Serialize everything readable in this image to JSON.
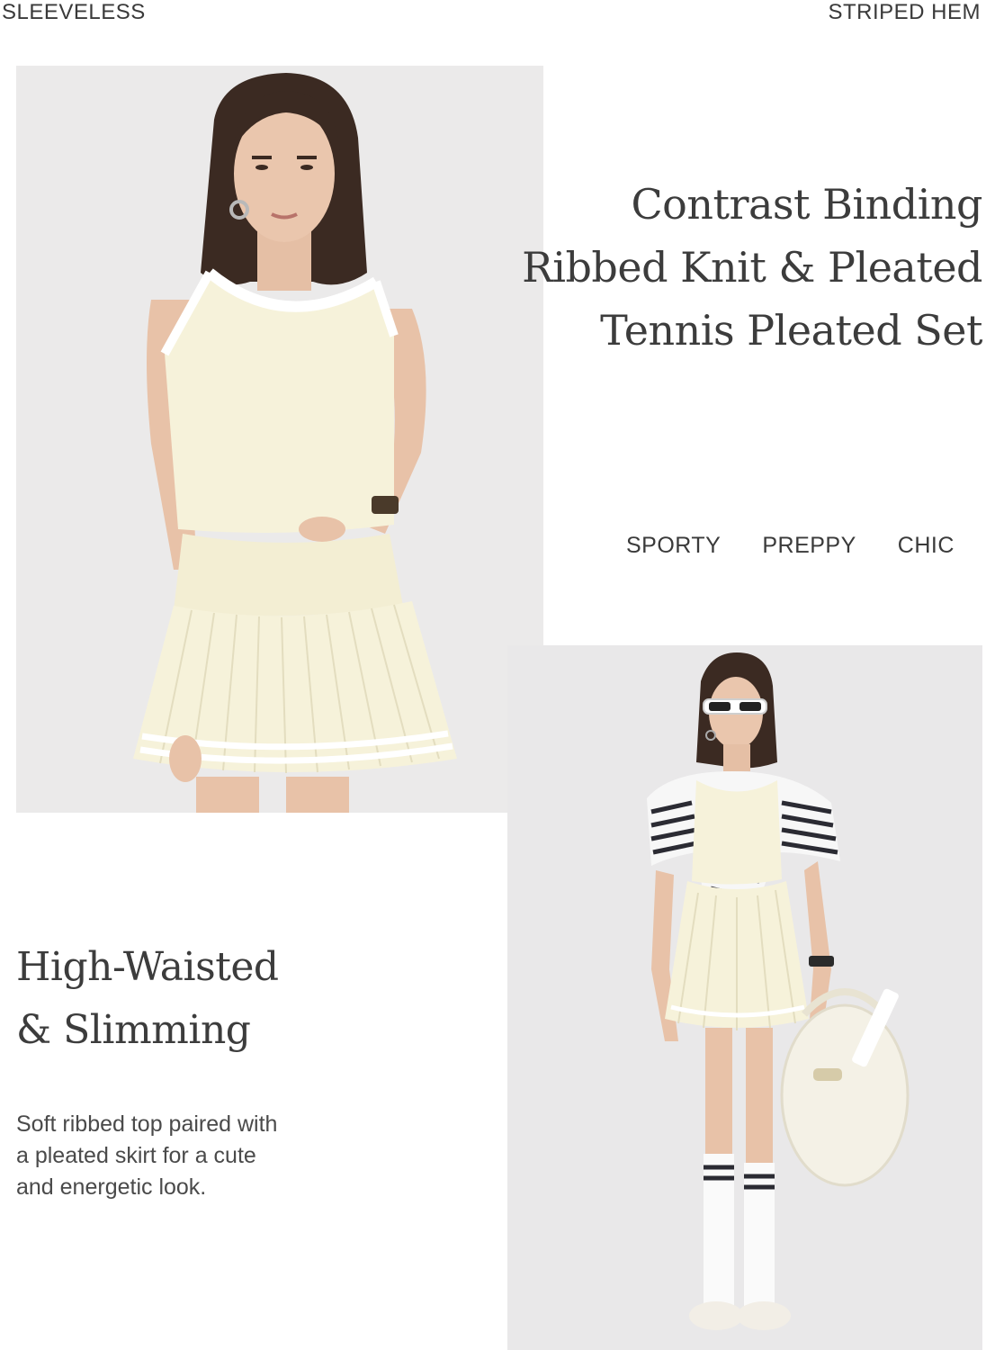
{
  "top_labels": {
    "left": "SLEEVELESS",
    "right": "STRIPED HEM"
  },
  "headline": {
    "line1": "Contrast Binding",
    "line2": "Ribbed Knit & Pleated",
    "line3": "Tennis Pleated Set"
  },
  "tags": [
    "SPORTY",
    "PREPPY",
    "CHIC"
  ],
  "subhead": {
    "line1": "High-Waisted",
    "line2": "& Slimming"
  },
  "description": {
    "line1": "Soft ribbed top paired with",
    "line2": "a pleated skirt for a cute",
    "line3": "and energetic look."
  },
  "colors": {
    "outfit": "#f6f2da",
    "trim": "#ffffff",
    "hair": "#3b2a22",
    "skin": "#e8c2a8",
    "background": "#ebeaea",
    "stripe": "#2b2b33"
  }
}
